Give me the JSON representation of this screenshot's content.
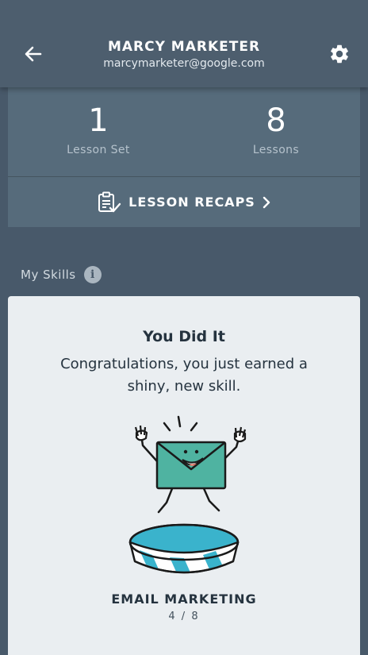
{
  "header": {
    "name": "MARCY MARKETER",
    "email": "marcymarketer@google.com",
    "back_icon": "arrow-left-icon",
    "settings_icon": "gear-icon"
  },
  "stats": {
    "lesson_sets": {
      "value": "1",
      "label": "Lesson Set"
    },
    "lessons": {
      "value": "8",
      "label": "Lessons"
    },
    "recaps": {
      "label": "LESSON RECAPS",
      "icon": "clipboard-check-icon",
      "arrow": "chevron-right-icon"
    }
  },
  "skills": {
    "title": "My Skills",
    "info_icon_glyph": "i",
    "card": {
      "title": "You Did It",
      "message": "Congratulations, you just earned a shiny, new skill.",
      "skill_name": "EMAIL MARKETING",
      "progress": "4 / 8",
      "progress_value": 0.5,
      "illustration": "happy-envelope-on-pedestal"
    }
  },
  "colors": {
    "background": "#48596a",
    "header": "#4d5e6e",
    "stats_card": "#566b7b",
    "skill_card": "#eaeef1",
    "envelope": "#4fb3a1",
    "pedestal": "#3ab3cc",
    "text_dark": "#25333f"
  }
}
